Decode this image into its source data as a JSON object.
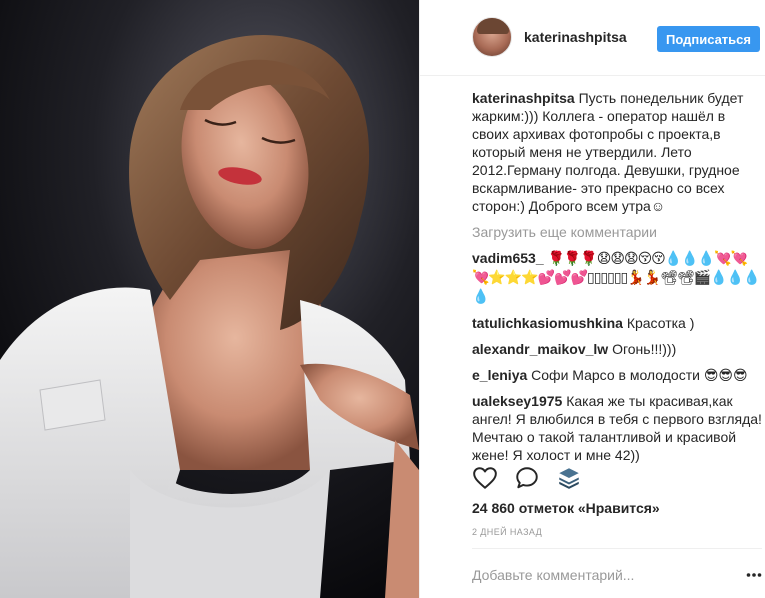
{
  "post": {
    "username": "katerinashpitsa",
    "follow_label": "Подписаться",
    "caption": {
      "username": "katerinashpitsa",
      "text": "Пусть понедельник будет жарким:))) Коллега - оператор нашёл в своих архивах фотопробы с проекта,в который меня не утвердили. Лето 2012.Герману полгода. Девушки, грудное вскармливание- это прекрасно со всех сторон:) Доброго всем утра☺"
    },
    "load_more_label": "Загрузить еще комментарии",
    "comments": [
      {
        "username": "vadim653_",
        "text": "🌹🌹🌹😧😧😧😚😚💧💧💧💘💘💘⭐⭐⭐💕💕💕▯▯▯▯▯▯💃💃📽📽🎬💧💧💧💧"
      },
      {
        "username": "tatulichkasiomushkina",
        "text": "Красотка )"
      },
      {
        "username": "alexandr_maikov_lw",
        "text": "Огонь!!!)))"
      },
      {
        "username": "e_leniya",
        "text": "Софи Марсо в молодости 😎😎😎"
      },
      {
        "username": "ualeksey1975",
        "text": "Какая же ты красивая,как ангел! Я влюбился в тебя с первого взгляда! Мечтаю о такой талантливой и красивой жене! Я холост и мне 42))"
      }
    ],
    "actions": {
      "like_icon": "heart-outline-icon",
      "comment_icon": "speech-bubble-icon",
      "save_icon": "layers-stack-icon"
    },
    "likes_text": "24 860 отметок «Нравится»",
    "date_text": "2 дней назад",
    "add_comment_placeholder": "Добавьте комментарий...",
    "more_icon": "ellipsis-icon",
    "colors": {
      "follow_button": "#3897f0",
      "muted_text": "#999999",
      "stack_icon": "#3b5f7a"
    }
  }
}
